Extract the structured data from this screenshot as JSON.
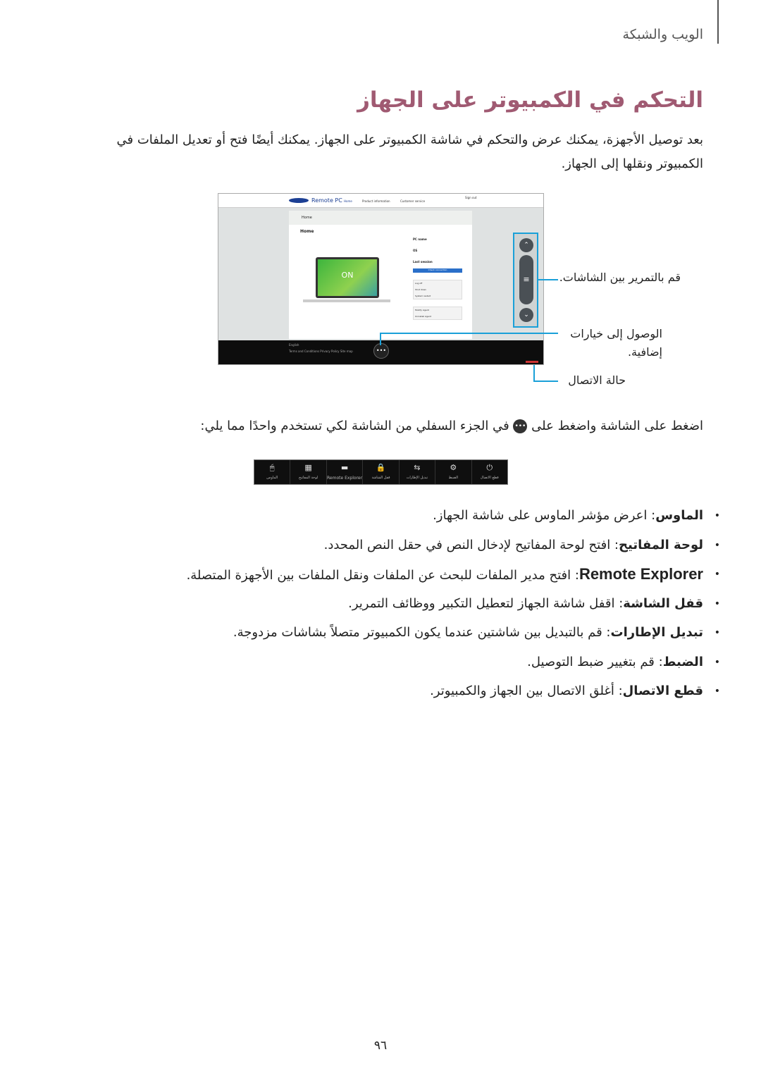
{
  "header": {
    "section": "الويب والشبكة"
  },
  "title": "التحكم في الكمبيوتر على الجهاز",
  "intro": "بعد توصيل الأجهزة، يمكنك عرض والتحكم في شاشة الكمبيوتر على الجهاز. يمكنك أيضًا فتح أو تعديل الملفات في الكمبيوتر ونقلها إلى الجهاز.",
  "screenshot": {
    "brand": "SAMSUNG",
    "app": "Remote PC",
    "nav": [
      "Home",
      "Product information",
      "Customer service"
    ],
    "signout": "Sign out",
    "panel_title": "Home",
    "heading": "Home",
    "on": "ON",
    "pc_name_label": "PC name",
    "os_label": "OS",
    "last_session": "Last session",
    "check_btn": "Check connection",
    "actions": [
      "Log off",
      "Shut down",
      "System restart"
    ],
    "agent": [
      "Modify Agent",
      "Uninstall Agent"
    ],
    "footer_lang": "English",
    "footer_links": "Terms and Conditions   Privacy Policy   Site map"
  },
  "callouts": {
    "scroll": "قم بالتمرير بين الشاشات.",
    "options": "الوصول إلى خيارات إضافية.",
    "status": "حالة الاتصال"
  },
  "instruction": {
    "before": "اضغط على الشاشة واضغط على",
    "after": "في الجزء السفلي من الشاشة لكي تستخدم واحدًا مما يلي:"
  },
  "toolbar": [
    {
      "icon": "mouse-icon",
      "glyph": "🖱",
      "label": "الماوس"
    },
    {
      "icon": "keyboard-icon",
      "glyph": "▦",
      "label": "لوحة المفاتيح"
    },
    {
      "icon": "folder-icon",
      "glyph": "▬",
      "label": "Remote Explorer"
    },
    {
      "icon": "lock-icon",
      "glyph": "🔒",
      "label": "قفل الشاشة"
    },
    {
      "icon": "switch-icon",
      "glyph": "⇆",
      "label": "تبديل الإطارات"
    },
    {
      "icon": "gear-icon",
      "glyph": "⚙",
      "label": "الضبط"
    },
    {
      "icon": "power-icon",
      "glyph": "⏻",
      "label": "قطع الاتصال"
    }
  ],
  "bullets": [
    {
      "term": "الماوس",
      "text": "اعرض مؤشر الماوس على شاشة الجهاز."
    },
    {
      "term": "لوحة المفاتيح",
      "text": "افتح لوحة المفاتيح لإدخال النص في حقل النص المحدد."
    },
    {
      "term": "Remote Explorer",
      "text": "افتح مدير الملفات للبحث عن الملفات ونقل الملفات بين الأجهزة المتصلة."
    },
    {
      "term": "قفل الشاشة",
      "text": "اقفل شاشة الجهاز لتعطيل التكبير ووظائف التمرير."
    },
    {
      "term": "تبديل الإطارات",
      "text": "قم بالتبديل بين شاشتين عندما يكون الكمبيوتر متصلاً بشاشات مزدوجة."
    },
    {
      "term": "الضبط",
      "text": "قم بتغيير ضبط التوصيل."
    },
    {
      "term": "قطع الاتصال",
      "text": "أغلق الاتصال بين الجهاز والكمبيوتر."
    }
  ],
  "page_number": "٩٦",
  "colors": {
    "title": "#a05a72",
    "callout_line": "#1aa0d8"
  }
}
